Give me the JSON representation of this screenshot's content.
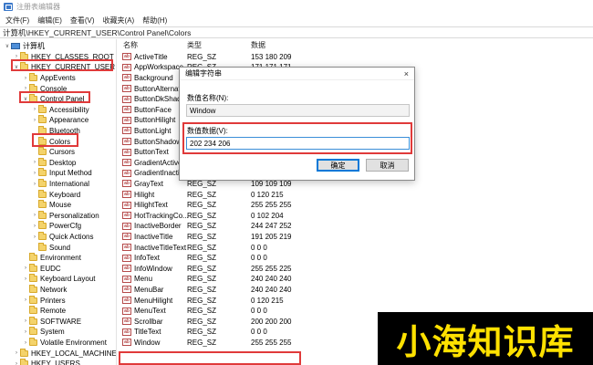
{
  "window": {
    "title": "注册表编辑器"
  },
  "menu": [
    "文件(F)",
    "编辑(E)",
    "查看(V)",
    "收藏夹(A)",
    "帮助(H)"
  ],
  "address": "计算机\\HKEY_CURRENT_USER\\Control Panel\\Colors",
  "tree": [
    {
      "label": "计算机",
      "indent": 0,
      "icon": "pc",
      "arrow": "open"
    },
    {
      "label": "HKEY_CLASSES_ROOT",
      "indent": 1,
      "icon": "folder",
      "arrow": "closed"
    },
    {
      "label": "HKEY_CURRENT_USER",
      "indent": 1,
      "icon": "folder",
      "arrow": "open"
    },
    {
      "label": "AppEvents",
      "indent": 2,
      "icon": "folder",
      "arrow": "closed"
    },
    {
      "label": "Console",
      "indent": 2,
      "icon": "folder",
      "arrow": "closed"
    },
    {
      "label": "Control Panel",
      "indent": 2,
      "icon": "folder",
      "arrow": "open"
    },
    {
      "label": "Accessibility",
      "indent": 3,
      "icon": "folder",
      "arrow": "closed"
    },
    {
      "label": "Appearance",
      "indent": 3,
      "icon": "folder",
      "arrow": "closed"
    },
    {
      "label": "Bluetooth",
      "indent": 3,
      "icon": "folder",
      "arrow": "none"
    },
    {
      "label": "Colors",
      "indent": 3,
      "icon": "folder",
      "arrow": "none"
    },
    {
      "label": "Cursors",
      "indent": 3,
      "icon": "folder",
      "arrow": "none"
    },
    {
      "label": "Desktop",
      "indent": 3,
      "icon": "folder",
      "arrow": "closed"
    },
    {
      "label": "Input Method",
      "indent": 3,
      "icon": "folder",
      "arrow": "closed"
    },
    {
      "label": "International",
      "indent": 3,
      "icon": "folder",
      "arrow": "closed"
    },
    {
      "label": "Keyboard",
      "indent": 3,
      "icon": "folder",
      "arrow": "none"
    },
    {
      "label": "Mouse",
      "indent": 3,
      "icon": "folder",
      "arrow": "none"
    },
    {
      "label": "Personalization",
      "indent": 3,
      "icon": "folder",
      "arrow": "closed"
    },
    {
      "label": "PowerCfg",
      "indent": 3,
      "icon": "folder",
      "arrow": "closed"
    },
    {
      "label": "Quick Actions",
      "indent": 3,
      "icon": "folder",
      "arrow": "closed"
    },
    {
      "label": "Sound",
      "indent": 3,
      "icon": "folder",
      "arrow": "none"
    },
    {
      "label": "Environment",
      "indent": 2,
      "icon": "folder",
      "arrow": "none"
    },
    {
      "label": "EUDC",
      "indent": 2,
      "icon": "folder",
      "arrow": "closed"
    },
    {
      "label": "Keyboard Layout",
      "indent": 2,
      "icon": "folder",
      "arrow": "closed"
    },
    {
      "label": "Network",
      "indent": 2,
      "icon": "folder",
      "arrow": "none"
    },
    {
      "label": "Printers",
      "indent": 2,
      "icon": "folder",
      "arrow": "closed"
    },
    {
      "label": "Remote",
      "indent": 2,
      "icon": "folder",
      "arrow": "none"
    },
    {
      "label": "SOFTWARE",
      "indent": 2,
      "icon": "folder",
      "arrow": "closed"
    },
    {
      "label": "System",
      "indent": 2,
      "icon": "folder",
      "arrow": "closed"
    },
    {
      "label": "Volatile Environment",
      "indent": 2,
      "icon": "folder",
      "arrow": "closed"
    },
    {
      "label": "HKEY_LOCAL_MACHINE",
      "indent": 1,
      "icon": "folder",
      "arrow": "closed"
    },
    {
      "label": "HKEY_USERS",
      "indent": 1,
      "icon": "folder",
      "arrow": "closed"
    }
  ],
  "columns": {
    "name": "名称",
    "type": "类型",
    "data": "数据"
  },
  "values": [
    {
      "name": "ActiveTitle",
      "type": "REG_SZ",
      "data": "153 180 209"
    },
    {
      "name": "AppWorkspace",
      "type": "REG_SZ",
      "data": "171 171 171"
    },
    {
      "name": "Background",
      "type": "REG_SZ",
      "data": ""
    },
    {
      "name": "ButtonAlternat...",
      "type": "REG_SZ",
      "data": ""
    },
    {
      "name": "ButtonDkShad...",
      "type": "REG_SZ",
      "data": ""
    },
    {
      "name": "ButtonFace",
      "type": "REG_SZ",
      "data": ""
    },
    {
      "name": "ButtonHilight",
      "type": "REG_SZ",
      "data": ""
    },
    {
      "name": "ButtonLight",
      "type": "REG_SZ",
      "data": ""
    },
    {
      "name": "ButtonShadow",
      "type": "REG_SZ",
      "data": ""
    },
    {
      "name": "ButtonText",
      "type": "REG_SZ",
      "data": ""
    },
    {
      "name": "GradientActive...",
      "type": "REG_SZ",
      "data": ""
    },
    {
      "name": "GradientInactiv...",
      "type": "REG_SZ",
      "data": "215 228 242"
    },
    {
      "name": "GrayText",
      "type": "REG_SZ",
      "data": "109 109 109"
    },
    {
      "name": "Hilight",
      "type": "REG_SZ",
      "data": "0 120 215"
    },
    {
      "name": "HilightText",
      "type": "REG_SZ",
      "data": "255 255 255"
    },
    {
      "name": "HotTrackingCo...",
      "type": "REG_SZ",
      "data": "0 102 204"
    },
    {
      "name": "InactiveBorder",
      "type": "REG_SZ",
      "data": "244 247 252"
    },
    {
      "name": "InactiveTitle",
      "type": "REG_SZ",
      "data": "191 205 219"
    },
    {
      "name": "InactiveTitleText",
      "type": "REG_SZ",
      "data": "0 0 0"
    },
    {
      "name": "InfoText",
      "type": "REG_SZ",
      "data": "0 0 0"
    },
    {
      "name": "InfoWindow",
      "type": "REG_SZ",
      "data": "255 255 225"
    },
    {
      "name": "Menu",
      "type": "REG_SZ",
      "data": "240 240 240"
    },
    {
      "name": "MenuBar",
      "type": "REG_SZ",
      "data": "240 240 240"
    },
    {
      "name": "MenuHilight",
      "type": "REG_SZ",
      "data": "0 120 215"
    },
    {
      "name": "MenuText",
      "type": "REG_SZ",
      "data": "0 0 0"
    },
    {
      "name": "Scrollbar",
      "type": "REG_SZ",
      "data": "200 200 200"
    },
    {
      "name": "TitleText",
      "type": "REG_SZ",
      "data": "0 0 0"
    },
    {
      "name": "Window",
      "type": "REG_SZ",
      "data": "255 255 255"
    }
  ],
  "dialog": {
    "title": "编辑字符串",
    "close": "×",
    "name_label": "数值名称(N):",
    "name_value": "Window",
    "data_label": "数值数据(V):",
    "data_value": "202 234 206",
    "ok": "确定",
    "cancel": "取消"
  },
  "watermark": "小海知识库",
  "colors": {
    "highlight_box": "#e03a3a",
    "watermark_text": "#ffe100",
    "watermark_bg": "#000000",
    "ok_border": "#0078d7"
  }
}
